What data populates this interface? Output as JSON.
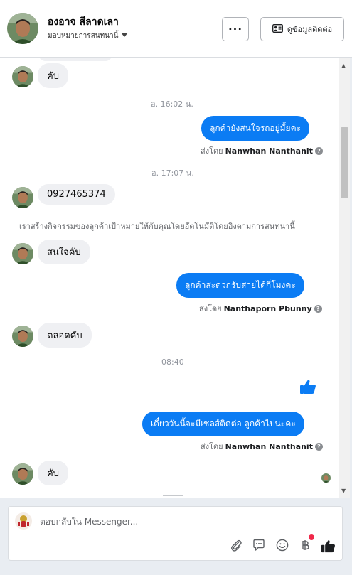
{
  "header": {
    "name": "องอาจ สีลาดเลา",
    "subtitle": "มอบหมายการสนทนานี้",
    "more_label": "···",
    "contact_label": "ดูข้อมูลติดต่อ"
  },
  "messages": {
    "m1": "คับ",
    "ts1": "อ. 16:02 น.",
    "out1": "ลูกค้ายังสนใจรถอยู่มั้ยคะ",
    "sent_prefix": "ส่งโดย",
    "out1_sender": "Nanwhan Nanthanit",
    "ts2": "อ. 17:07 น.",
    "m2": "0927465374",
    "system_note": "เราสร้างกิจกรรมของลูกค้าเป้าหมายให้กับคุณโดยอัตโนมัติโดยอิงตามการสนทนานี้",
    "m3": "สนใจคับ",
    "out2": "ลูกค้าสะดวกรับสายได้กี่โมงคะ",
    "out2_sender": "Nanthaporn Pbunny",
    "m4": "ตลอดคับ",
    "ts3": "08:40",
    "out4": "เดี๋ยววันนี้จะมีเซลส์ติดต่อ ลูกค้าไปนะคะ",
    "out4_sender": "Nanwhan Nanthanit",
    "m5": "คับ"
  },
  "composer": {
    "placeholder": "ตอบกลับใน Messenger..."
  },
  "icons": {
    "attach": "paperclip-icon",
    "saved_replies": "speech-bubble-icon",
    "emoji": "smiley-icon",
    "payment": "baht-icon",
    "like": "thumbs-up-icon"
  },
  "colors": {
    "accent": "#0b7cf4",
    "badge": "#f02849"
  }
}
